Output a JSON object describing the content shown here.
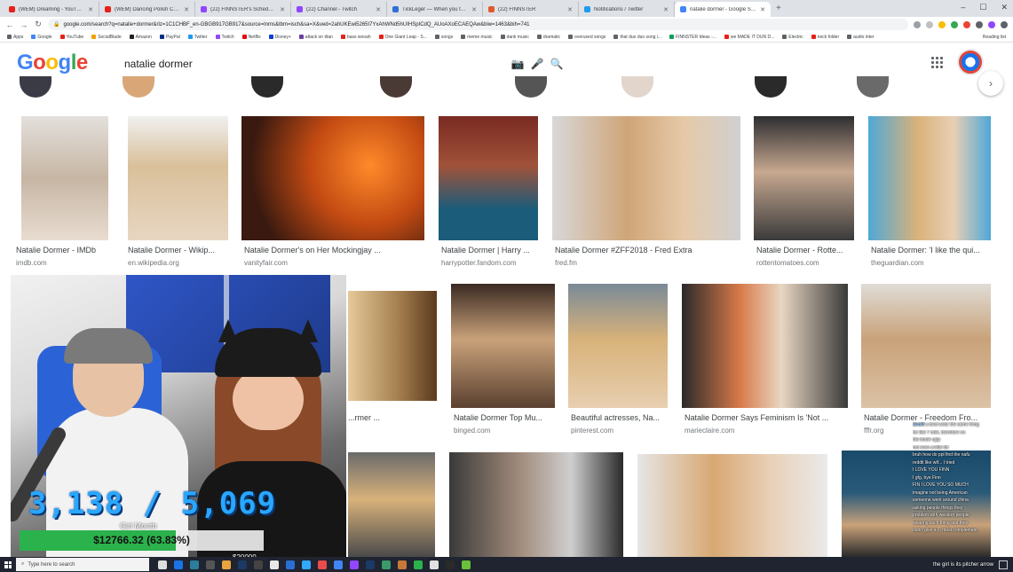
{
  "browser": {
    "tabs": [
      {
        "label": "(WEM) Dreaming - YouTube",
        "color": "#e62117",
        "active": false
      },
      {
        "label": "(WEM) Dancing Polish Cow 10 Hr",
        "color": "#e62117",
        "active": false
      },
      {
        "label": "(22) FINNSTER's Schedule · Twit",
        "color": "#9146ff",
        "active": false
      },
      {
        "label": "(22) Channel - Twitch",
        "color": "#9146ff",
        "active": false
      },
      {
        "label": "TickLeger — When you talk to",
        "color": "#2f6fd6",
        "active": false
      },
      {
        "label": "(22) FINNSTER",
        "color": "#e05a2b",
        "active": false
      },
      {
        "label": "Notifications / Twitter",
        "color": "#1d9bf0",
        "active": false
      },
      {
        "label": "natalie dormer - Google Search",
        "color": "#4285f4",
        "active": true
      }
    ],
    "new_tab_glyph": "+",
    "url": "google.com/search?q=natalie+dormer&rlz=1C1CHBF_en-GBGB917GB917&source=lnms&tbm=isch&sa=X&ved=2ahUKEwi5265I7YxAhWNd5hUIHSpICdQ_AUoAXoECAEQAw&biw=1463&bih=741",
    "bookmarks": [
      {
        "label": "Apps",
        "color": "#5f6368"
      },
      {
        "label": "Google",
        "color": "#4285f4"
      },
      {
        "label": "YouTube",
        "color": "#e62117"
      },
      {
        "label": "SocialBlade",
        "color": "#f4a100"
      },
      {
        "label": "Amazon",
        "color": "#222"
      },
      {
        "label": "PayPal",
        "color": "#003087"
      },
      {
        "label": "Twitter",
        "color": "#1d9bf0"
      },
      {
        "label": "Twitch",
        "color": "#9146ff"
      },
      {
        "label": "Netflix",
        "color": "#e50914"
      },
      {
        "label": "Disney+",
        "color": "#113ccf"
      },
      {
        "label": "attack on titan",
        "color": "#6b3fa0"
      },
      {
        "label": "bass wooah",
        "color": "#e62117"
      },
      {
        "label": "One Giant Leap - S...",
        "color": "#e62117"
      },
      {
        "label": "songs",
        "color": "#5f6368"
      },
      {
        "label": "meme music",
        "color": "#5f6368"
      },
      {
        "label": "dank music",
        "color": "#5f6368"
      },
      {
        "label": "dramatic",
        "color": "#5f6368"
      },
      {
        "label": "overused songs",
        "color": "#5f6368"
      },
      {
        "label": "that duo duo song i...",
        "color": "#5f6368"
      },
      {
        "label": "FINNSTER Ideas -...",
        "color": "#0f9d58"
      },
      {
        "label": "we MADE IT DUN D...",
        "color": "#e62117"
      },
      {
        "label": "Electric",
        "color": "#5f6368"
      },
      {
        "label": "neck folder",
        "color": "#e62117"
      },
      {
        "label": "audio inter",
        "color": "#5f6368"
      }
    ],
    "reading_list": "Reading list"
  },
  "google": {
    "logo": "Google",
    "query": "natalie dormer"
  },
  "results": [
    {
      "title": "Natalie Dormer - IMDb",
      "source": "imdb.com"
    },
    {
      "title": "Natalie Dormer - Wikip...",
      "source": "en.wikipedia.org"
    },
    {
      "title": "Natalie Dormer's on Her Mockingjay ...",
      "source": "vanityfair.com"
    },
    {
      "title": "Natalie Dormer | Harry ...",
      "source": "harrypotter.fandom.com"
    },
    {
      "title": "Natalie Dormer #ZFF2018 - Fred Extra",
      "source": "fred.fm"
    },
    {
      "title": "Natalie Dormer - Rotte...",
      "source": "rottentomatoes.com"
    },
    {
      "title": "Natalie Dormer: 'I like the qui...",
      "source": "theguardian.com"
    },
    {
      "title": "...rmer ...",
      "source": ""
    },
    {
      "title": "Natalie Dormer Top Mu...",
      "source": "binged.com"
    },
    {
      "title": "Beautiful actresses, Na...",
      "source": "pinterest.com"
    },
    {
      "title": "Natalie Dormer Says Feminism Is 'Not ...",
      "source": "marieclaire.com"
    },
    {
      "title": "Natalie Dormer - Freedom Fro...",
      "source": "fffr.org"
    }
  ],
  "stream": {
    "sub_counter": "3,138 / 5,069",
    "goal_label": "Girl Month",
    "goal_text": "$12766.32 (63.83%)",
    "goal_fraction": 0.6383,
    "goal_end": "$20000",
    "chat": [
      {
        "user": "Zeullt",
        "text": "u best wear the same thing"
      },
      {
        "user": "",
        "text": "for like 7 mile, therefore on"
      },
      {
        "user": "",
        "text": "the boule ugly"
      },
      {
        "user": "",
        "text": "not even a little bit"
      },
      {
        "user": "",
        "text": "bruh how do ppl find the nafu"
      },
      {
        "user": "",
        "text": "reddit like wtf... I tried"
      },
      {
        "user": "",
        "text": "I LOVE YOU FINN"
      },
      {
        "user": "",
        "text": "I gfg, bye Finn"
      },
      {
        "user": "",
        "text": "FIN I LOVE YOU SO MUCH"
      },
      {
        "user": "",
        "text": "imagine not being American"
      },
      {
        "user": "",
        "text": "someone went around china"
      },
      {
        "user": "",
        "text": "asking people things they"
      },
      {
        "user": "",
        "text": "problem with western people"
      },
      {
        "user": "",
        "text": "wearing such thing and they"
      },
      {
        "user": "",
        "text": "didn't give a F, most complement"
      }
    ],
    "bottom_caption": "the girl is its pitcher arrow"
  },
  "taskbar": {
    "search_placeholder": "Type here to search"
  }
}
